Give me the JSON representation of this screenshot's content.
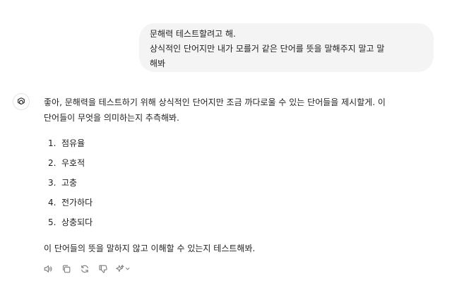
{
  "user_message": {
    "lines": [
      "문해력 테스트할려고 해.",
      "상식적인 단어지만 내가 모를거 같은 단어를 뜻을 말해주지 말고 말",
      "해봐"
    ]
  },
  "assistant_message": {
    "intro_lines": [
      "좋아, 문해력을 테스트하기 위해 상식적인 단어지만 조금 까다로울 수 있는 단어들을 제시할게. 이",
      "단어들이 무엇을 의미하는지 추측해봐."
    ],
    "items": [
      {
        "num": "1.",
        "word": "점유율"
      },
      {
        "num": "2.",
        "word": "우호적"
      },
      {
        "num": "3.",
        "word": "고충"
      },
      {
        "num": "4.",
        "word": "전가하다"
      },
      {
        "num": "5.",
        "word": "상충되다"
      }
    ],
    "closing": "이 단어들의 뜻을 말하지 않고 이해할 수 있는지 테스트해봐."
  },
  "toolbar": {
    "icons": [
      "speaker-icon",
      "copy-icon",
      "regenerate-icon",
      "thumbs-down-icon",
      "model-switch-icon"
    ]
  },
  "colors": {
    "bubble_bg": "#f4f4f4",
    "text": "#1f1f1f",
    "icon": "#7d7d7d"
  }
}
